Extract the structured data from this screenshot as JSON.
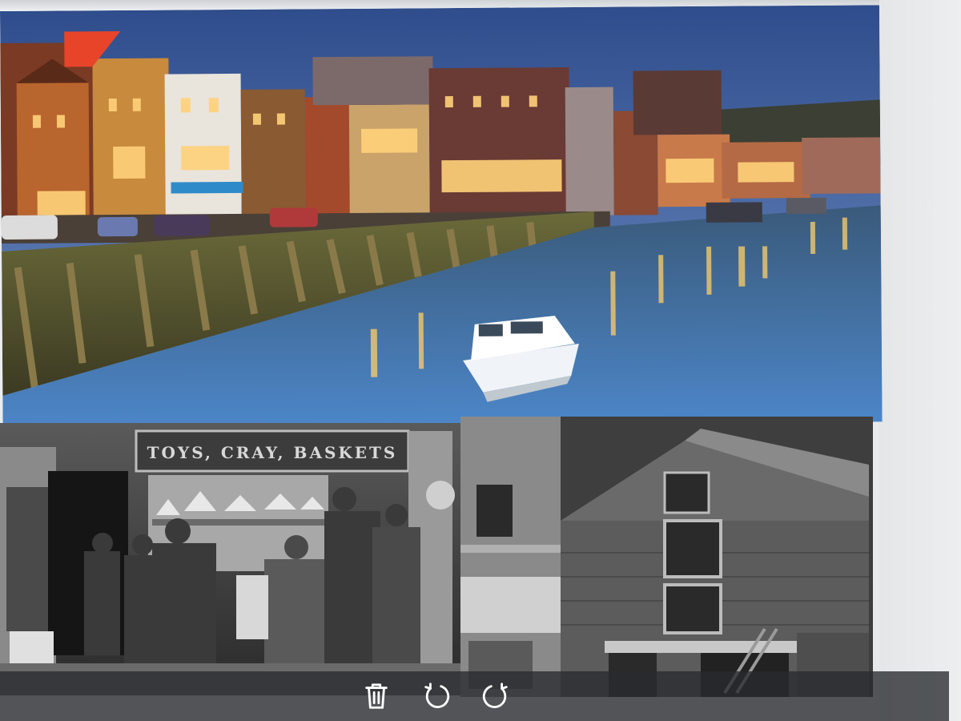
{
  "viewer": {
    "photos": [
      {
        "id": "harbour",
        "kind": "colour"
      },
      {
        "id": "shop",
        "kind": "black-and-white"
      },
      {
        "id": "building",
        "kind": "black-and-white"
      }
    ],
    "shop_sign": "TOYS, CRAY, BASKETS"
  },
  "toolbar": {
    "buttons": [
      {
        "name": "delete",
        "icon": "trash-icon"
      },
      {
        "name": "rotate-left",
        "icon": "rotate-left-icon"
      },
      {
        "name": "rotate-right",
        "icon": "rotate-right-icon"
      }
    ],
    "background": "#2a2c30",
    "icon_color": "#ffffff"
  }
}
